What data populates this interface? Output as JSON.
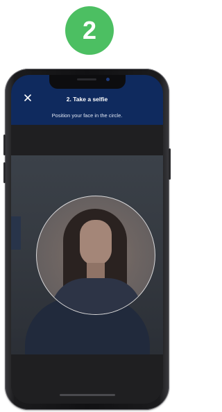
{
  "step": {
    "number": "2",
    "color": "#4cbf62"
  },
  "header": {
    "title": "2. Take a selfie",
    "subtitle": "Position your face in the circle.",
    "close_icon": "close-icon",
    "background": "#0f2a5e"
  }
}
